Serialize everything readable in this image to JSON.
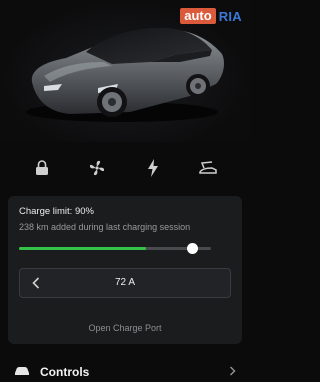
{
  "watermark": {
    "auto": "auto",
    "ria": "RIA"
  },
  "icons": [
    "lock-icon",
    "fan-icon",
    "charge-bolt-icon",
    "frunk-icon"
  ],
  "charging": {
    "limit_label": "Charge limit: 90%",
    "range_added": "238 km added during last charging session",
    "slider_fraction": 0.9,
    "current_fill_fraction": 0.66,
    "amps": "72 A",
    "open_port": "Open Charge Port"
  },
  "menu": {
    "controls_label": "Controls"
  },
  "colors": {
    "accent_green": "#34c24a",
    "panel_bg": "#1b1c1e",
    "page_bg": "#0b0b0c",
    "watermark_auto": "#db5a3b",
    "watermark_ria": "#3c79d6"
  }
}
